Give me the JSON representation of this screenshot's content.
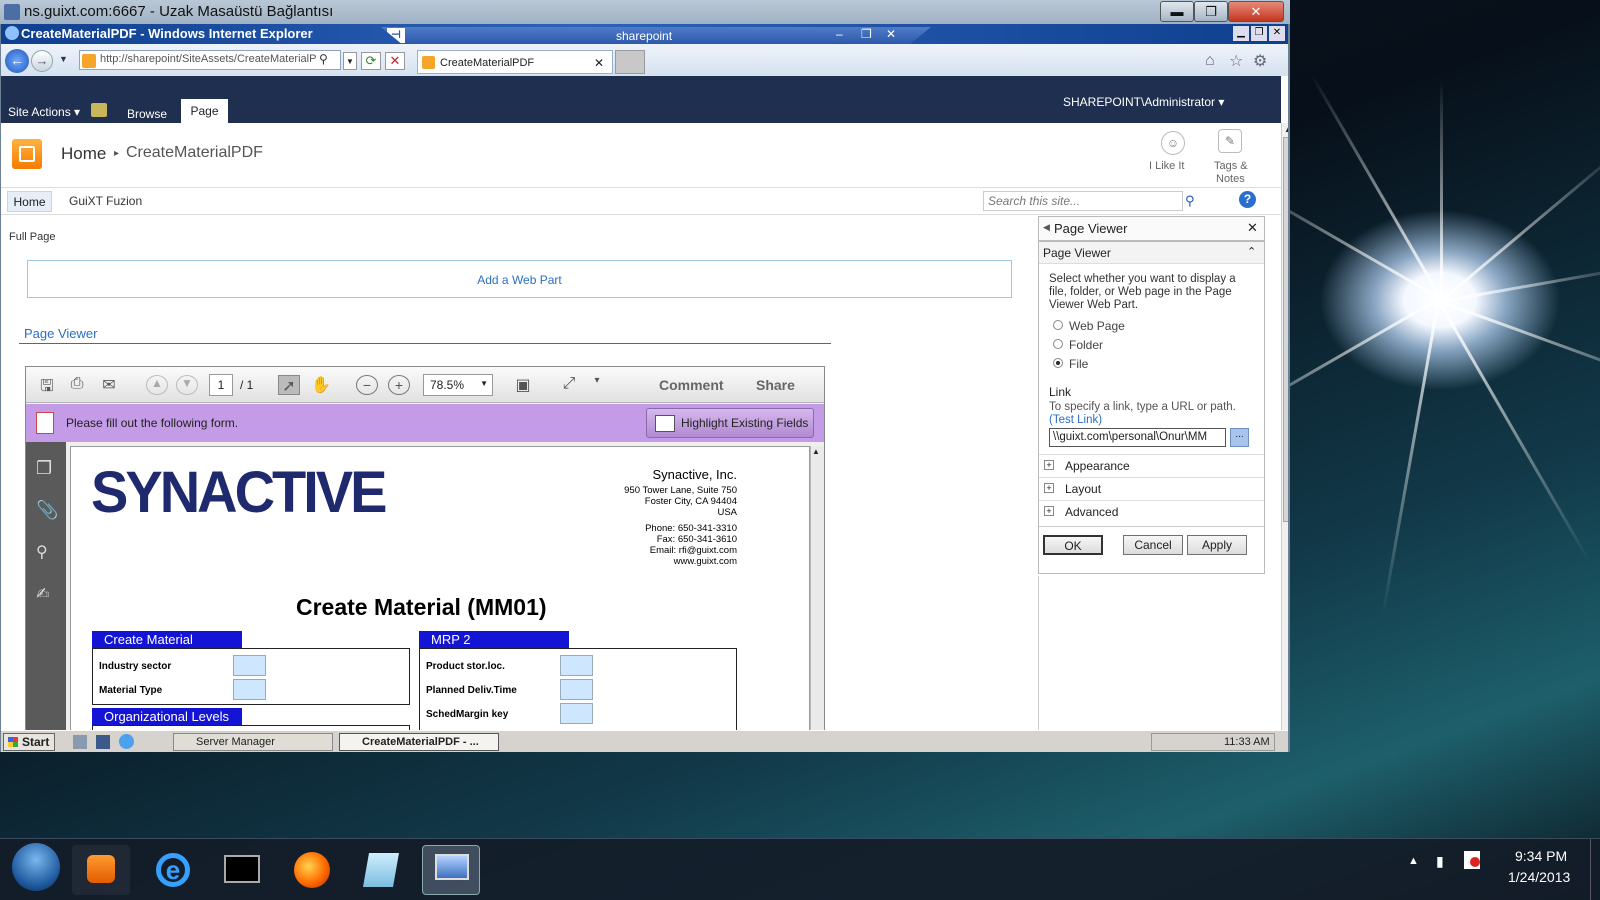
{
  "rdp": {
    "title": "ns.guixt.com:6667 - Uzak Masaüstü Bağlantısı",
    "min": "▬",
    "max": "❐",
    "close": "✕"
  },
  "ie": {
    "title": "CreateMaterialPDF - Windows Internet Explorer",
    "float_title": "sharepoint",
    "address": "http://sharepoint/SiteAssets/CreateMaterialP",
    "tab_label": "CreateMaterialPDF",
    "tab_close": "✕"
  },
  "ribbon": {
    "site_actions": "Site Actions",
    "browse": "Browse",
    "page": "Page",
    "user": "SHAREPOINT\\Administrator"
  },
  "header": {
    "home": "Home",
    "page_name": "CreateMaterialPDF",
    "like": "I Like It",
    "tags": "Tags &",
    "notes": "Notes"
  },
  "nav": {
    "home": "Home",
    "guixt": "GuiXT Fuzion",
    "search_placeholder": "Search this site..."
  },
  "content": {
    "full_page": "Full Page",
    "add_web_part": "Add a Web Part",
    "page_viewer": "Page Viewer"
  },
  "pdf": {
    "page_num": "1",
    "page_total": "/ 1",
    "zoom": "78.5%",
    "comment": "Comment",
    "share": "Share",
    "form_msg": "Please fill out the following form.",
    "highlight": "Highlight Existing Fields",
    "company": "SYNACTIVE",
    "company_name": "Synactive, Inc.",
    "addr1": "950 Tower Lane, Suite 750",
    "addr2": "Foster City, CA 94404",
    "addr3": "USA",
    "phone": "Phone: 650-341-3310",
    "fax": "Fax: 650-341-3610",
    "email": "Email: rfi@guixt.com",
    "web": "www.guixt.com",
    "doc_title": "Create Material (MM01)",
    "sec_create": "Create Material",
    "f_industry": "Industry sector",
    "f_material": "Material Type",
    "sec_org": "Organizational Levels",
    "sec_mrp": "MRP 2",
    "f_prod": "Product stor.loc.",
    "f_planned": "Planned Deliv.Time",
    "f_sched": "SchedMargin key"
  },
  "toolpane": {
    "header": "Page Viewer",
    "sub": "Page Viewer",
    "desc": "Select whether you want to display a file, folder, or Web page in the Page Viewer Web Part.",
    "opt_web": "Web Page",
    "opt_folder": "Folder",
    "opt_file": "File",
    "link_label": "Link",
    "link_desc": "To specify a link, type a URL or path.",
    "test_link": "(Test Link)",
    "link_value": "\\\\guixt.com\\personal\\Onur\\MM",
    "browse": "...",
    "appearance": "Appearance",
    "layout": "Layout",
    "advanced": "Advanced",
    "ok": "OK",
    "cancel": "Cancel",
    "apply": "Apply"
  },
  "inner_taskbar": {
    "start": "Start",
    "server_manager": "Server Manager",
    "ie_task": "CreateMaterialPDF - ...",
    "clock": "11:33 AM"
  },
  "taskbar": {
    "time": "9:34 PM",
    "date": "1/24/2013"
  }
}
